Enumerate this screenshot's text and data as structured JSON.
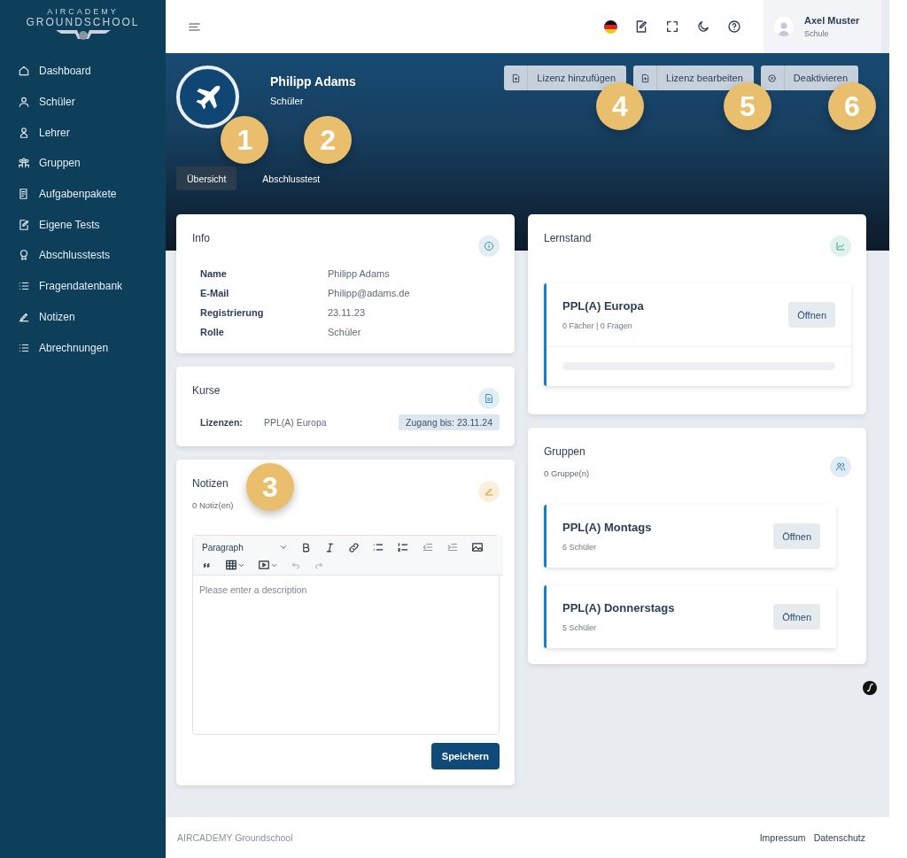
{
  "sidebar": {
    "logo": {
      "line_1": "AIRCADEMY",
      "line_2": "GROUNDSCHOOL"
    },
    "items": [
      {
        "label": "Dashboard",
        "kind": "home"
      },
      {
        "label": "Schüler",
        "kind": "user"
      },
      {
        "label": "Lehrer",
        "kind": "teacher"
      },
      {
        "label": "Gruppen",
        "kind": "group"
      },
      {
        "label": "Aufgabenpakete",
        "kind": "doc"
      },
      {
        "label": "Eigene Tests",
        "kind": "edit"
      },
      {
        "label": "Abschlusstests",
        "kind": "award"
      },
      {
        "label": "Fragendatenbank",
        "kind": "list"
      },
      {
        "label": "Notizen",
        "kind": "pen"
      },
      {
        "label": "Abrechnungen",
        "kind": "list"
      }
    ]
  },
  "user": {
    "name": "Axel Muster",
    "role": "Schule"
  },
  "profile": {
    "name": "Philipp Adams",
    "role": "Schüler"
  },
  "actions": [
    {
      "label": "Lizenz hinzufügen",
      "kind": "add",
      "callout": "4"
    },
    {
      "label": "Lizenz bearbeiten",
      "kind": "add",
      "callout": "5"
    },
    {
      "label": "Deaktivieren",
      "kind": "deactivate",
      "callout": "6"
    }
  ],
  "tabs": [
    {
      "label": "Übersicht",
      "selected": true,
      "callout": "1"
    },
    {
      "label": "Abschlusstest",
      "selected": false,
      "callout": "2"
    }
  ],
  "info": {
    "title": "Info",
    "rows": [
      {
        "label": "Name",
        "value": "Philipp Adams"
      },
      {
        "label": "E-Mail",
        "value": "Philipp@adams.de"
      },
      {
        "label": "Registrierung",
        "value": "23.11.23"
      },
      {
        "label": "Rolle",
        "value": "Schüler"
      }
    ]
  },
  "courses": {
    "title": "Kurse",
    "label": "Lizenzen:",
    "value": "PPL(A) Europa",
    "badge": "Zugang bis: 23.11.24"
  },
  "notes": {
    "title": "Notizen",
    "count": "0 Notiz(en)",
    "callout": "3",
    "style_select": "Paragraph",
    "placeholder": "Please enter a description",
    "save": "Speichern"
  },
  "progress": {
    "title": "Lernstand",
    "items": [
      {
        "name": "PPL(A) Europa",
        "meta": "0 Fächer | 0 Fragen",
        "button": "Öffnen",
        "level": 0
      }
    ]
  },
  "groups": {
    "title": "Gruppen",
    "count": "0 Gruppe(n)",
    "items": [
      {
        "name": "PPL(A) Montags",
        "meta": "6 Schüler",
        "button": "Öffnen"
      },
      {
        "name": "PPL(A) Donnerstags",
        "meta": "5 Schüler",
        "button": "Öffnen"
      }
    ]
  },
  "footer": {
    "brand": "AIRCADEMY Groundschool",
    "links": [
      "Impressum",
      "Datenschutz"
    ]
  }
}
